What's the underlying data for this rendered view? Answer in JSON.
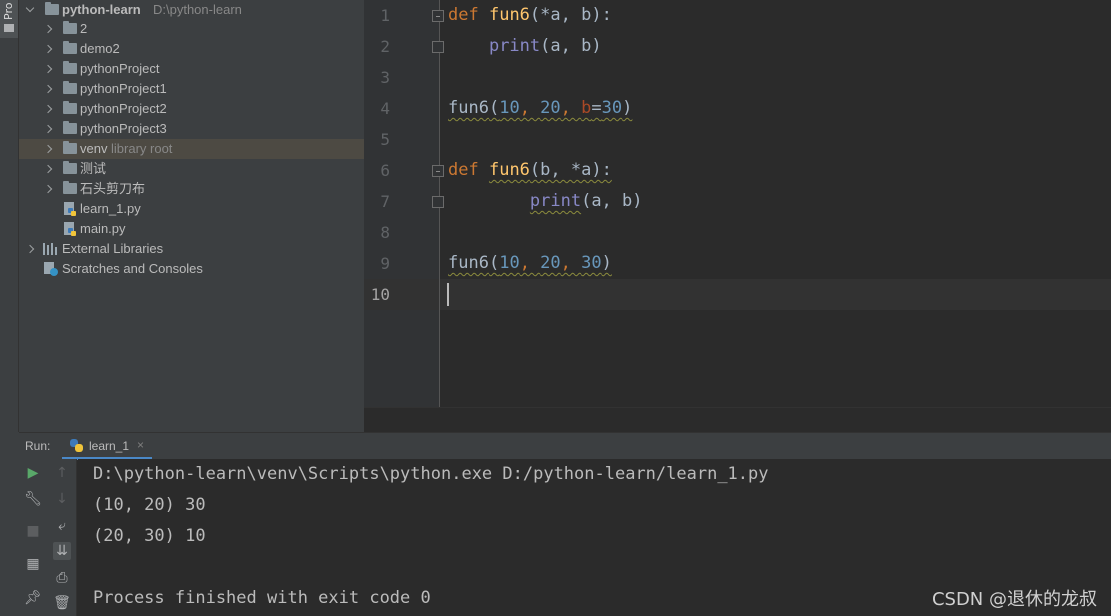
{
  "sidebar_tab": {
    "label": "Pro"
  },
  "project_tree": {
    "root": {
      "name": "python-learn",
      "path": "D:\\python-learn"
    },
    "items": [
      {
        "label": "2",
        "hint": ""
      },
      {
        "label": "demo2",
        "hint": ""
      },
      {
        "label": "pythonProject",
        "hint": ""
      },
      {
        "label": "pythonProject1",
        "hint": ""
      },
      {
        "label": "pythonProject2",
        "hint": ""
      },
      {
        "label": "pythonProject3",
        "hint": ""
      },
      {
        "label": "venv",
        "hint": "library root"
      },
      {
        "label": "测试",
        "hint": ""
      },
      {
        "label": "石头剪刀布",
        "hint": ""
      }
    ],
    "files": [
      "learn_1.py",
      "main.py"
    ],
    "external_libraries": "External Libraries",
    "scratches": "Scratches and Consoles"
  },
  "editor": {
    "line_numbers": [
      "1",
      "2",
      "3",
      "4",
      "5",
      "6",
      "7",
      "8",
      "9",
      "10"
    ],
    "current_line": "10",
    "code": {
      "l1": {
        "kw": "def",
        "fn": "fun6",
        "rest": "(*a, b):"
      },
      "l2": {
        "builtin": "print",
        "rest": "(a, b)"
      },
      "l4": {
        "call": "fun6",
        "open": "(",
        "n1": "10",
        "sep1": ", ",
        "n2": "20",
        "sep2": ", ",
        "param": "b",
        "eq": "=",
        "n3": "30",
        "close": ")"
      },
      "l6": {
        "kw": "def",
        "fn": "fun6",
        "rest": "(b, *a):"
      },
      "l7": {
        "builtin": "print",
        "rest": "(a, b)"
      },
      "l9": {
        "call": "fun6",
        "open": "(",
        "n1": "10",
        "sep1": ", ",
        "n2": "20",
        "sep2": ", ",
        "n3": "30",
        "close": ")"
      }
    }
  },
  "run_panel": {
    "label": "Run:",
    "tab": "learn_1",
    "close": "×",
    "console": [
      "D:\\python-learn\\venv\\Scripts\\python.exe D:/python-learn/learn_1.py",
      "(10, 20) 30",
      "(20, 30) 10",
      "",
      "Process finished with exit code 0"
    ]
  },
  "watermark": "CSDN @退休的龙叔",
  "colors": {
    "keyword": "#cc7832",
    "function": "#ffc66d",
    "builtin": "#8888c6",
    "number": "#6897bb",
    "param": "#aa4926",
    "run_accent": "#59a869"
  }
}
